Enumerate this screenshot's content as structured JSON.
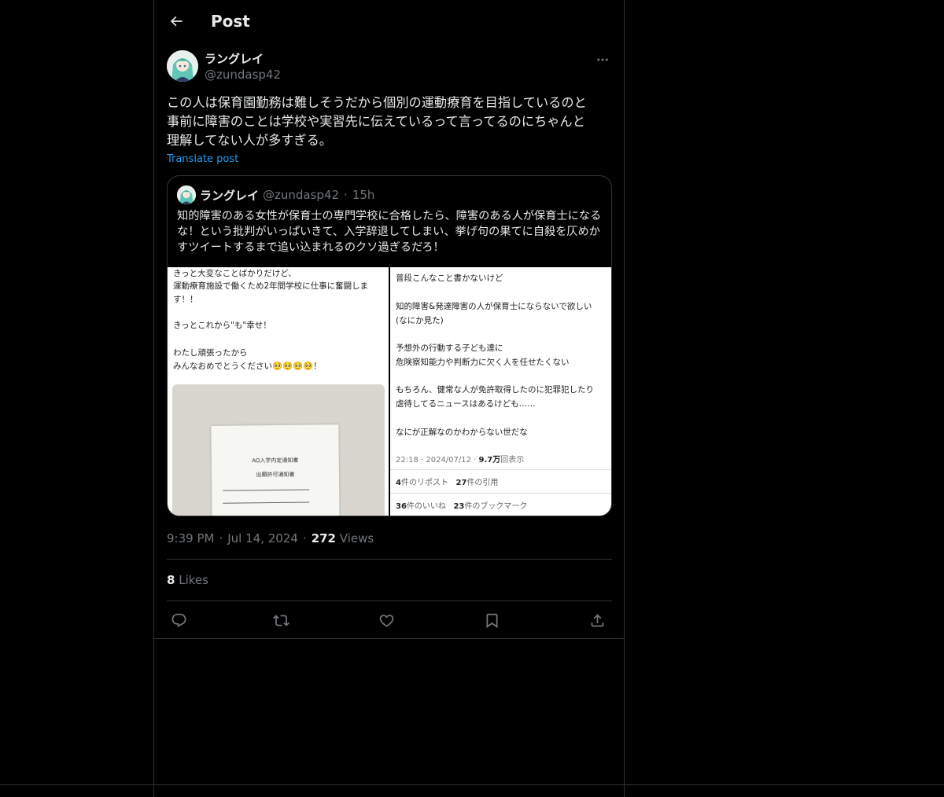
{
  "header": {
    "title": "Post"
  },
  "post": {
    "author_name": "ラングレイ",
    "author_handle": "@zundasp42",
    "text": "この人は保育園勤務は難しそうだから個別の運動療育を目指しているのと\n事前に障害のことは学校や実習先に伝えているって言ってるのにちゃんと\n理解してない人が多すぎる。",
    "translate_label": "Translate post",
    "time": "9:39 PM",
    "date": "Jul 14, 2024",
    "views_count": "272",
    "views_label": "Views",
    "likes_count": "8",
    "likes_label": "Likes"
  },
  "quote": {
    "author_name": "ラングレイ",
    "author_handle": "@zundasp42",
    "time_ago": "15h",
    "text": "知的障害のある女性が保育士の専門学校に合格したら、障害のある人が保育士になるな！という批判がいっぱいきて、入学辞退してしまい、挙げ句の果てに自殺を仄めかすツイートするまで追い込まれるのクソ過ぎるだろ！"
  },
  "image_left": {
    "line1": "きっと大変なことばかりだけど、",
    "line2": "運動療育施設で働くため2年間学校に仕事に奮闘しま",
    "line3": "す！！",
    "line4": "きっとこれから\"も\"幸せ！",
    "line5": "わたし頑張ったから",
    "line6": "みんなおめでとうください🥺🥺🥺🥺！",
    "paper_line1": "AO入学内定通知書",
    "paper_line2": "出願許可通知書"
  },
  "image_right": {
    "line1": "普段こんなこと書かないけど",
    "line2": "知的障害&発達障害の人が保育士にならないで欲しい",
    "line3": "(なにか見た)",
    "line4": "予想外の行動する子ども達に",
    "line5": "危険察知能力や判断力に欠く人を任せたくない",
    "line6": "もちろん、健常な人が免許取得したのに犯罪犯したり",
    "line7": "虐待してるニュースはあるけども……",
    "line8": "なにが正解なのかわからない世だな",
    "meta_time": "22:18 · 2024/07/12 · ",
    "meta_views": "9.7万",
    "meta_views_label": "回表示",
    "reposts_count": "4",
    "reposts_label": "件のリポスト",
    "quotes_count": "27",
    "quotes_label": "件の引用",
    "likes_count": "36",
    "likes_label": "件のいいね",
    "bookmarks_count": "23",
    "bookmarks_label": "件のブックマーク"
  },
  "icons": [
    "back-arrow-icon",
    "more-icon",
    "reply-icon",
    "repost-icon",
    "like-icon",
    "bookmark-icon",
    "share-icon"
  ],
  "colors": {
    "background": "#000000",
    "text": "#e7e9ea",
    "muted": "#71767b",
    "border": "#2f3336",
    "link": "#1d9bf0"
  }
}
